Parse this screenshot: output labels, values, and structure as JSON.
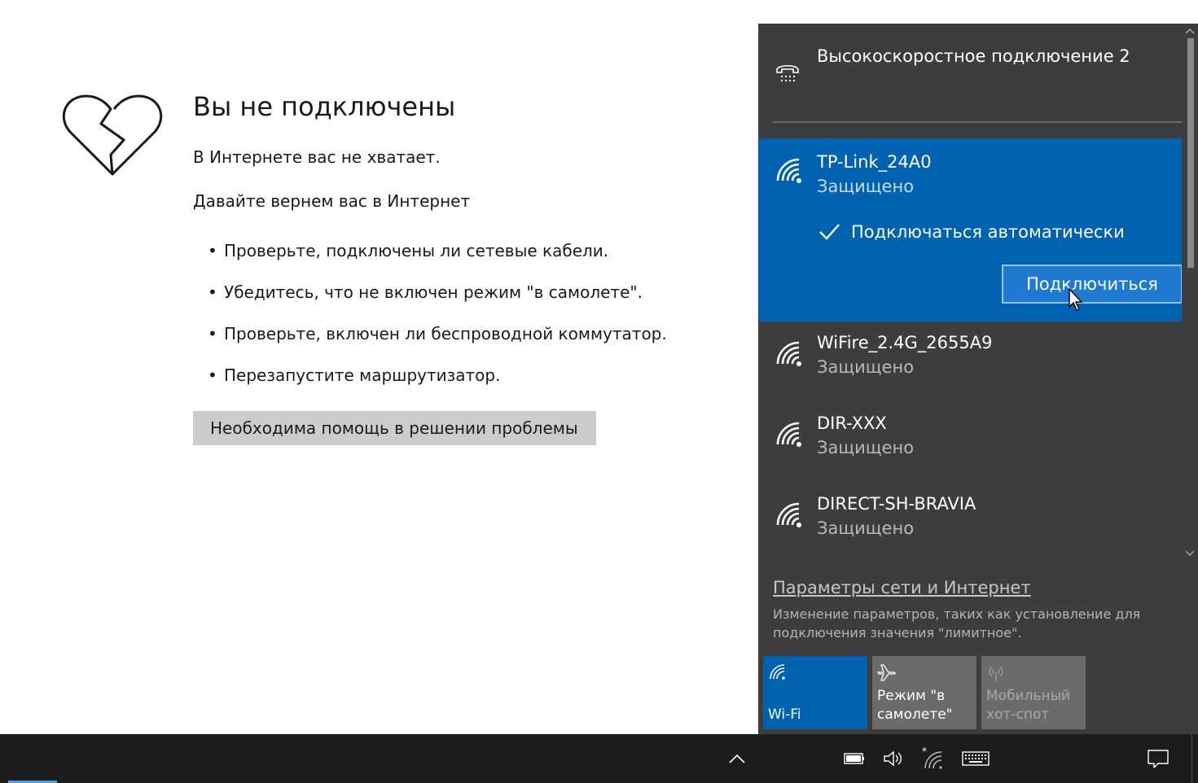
{
  "page": {
    "title": "Вы не подключены",
    "subtitle": "В Интернете вас не хватает.",
    "lead": "Давайте вернем вас в Интернет",
    "tips": [
      "Проверьте, подключены ли сетевые кабели.",
      "Убедитесь, что не включен режим \"в самолете\".",
      "Проверьте, включен ли беспроводной коммутатор.",
      "Перезапустите маршрутизатор."
    ],
    "help_button": "Необходима помощь в решении проблемы"
  },
  "flyout": {
    "dialup": {
      "name": "Высокоскоростное подключение 2",
      "icon": "dialup-icon"
    },
    "selected_network": {
      "name": "TP-Link_24A0",
      "status": "Защищено",
      "auto_connect_label": "Подключаться автоматически",
      "auto_connect_checked": true,
      "connect_button": "Подключиться"
    },
    "networks": [
      {
        "name": "WiFire_2.4G_2655A9",
        "status": "Защищено"
      },
      {
        "name": "DIR-XXX",
        "status": "Защищено"
      },
      {
        "name": "DIRECT-SH-BRAVIA",
        "status": "Защищено"
      }
    ],
    "settings_link": "Параметры сети и Интернет",
    "settings_desc": "Изменение параметров, таких как установление для подключения значения \"лимитное\".",
    "quick_actions": {
      "wifi": "Wi-Fi",
      "airplane": "Режим \"в самолете\"",
      "hotspot": "Мобильный хот-спот"
    }
  },
  "colors": {
    "accent": "#0063b1",
    "flyout_bg": "#3d3d3d",
    "taskbar_bg": "#1c1c1c"
  }
}
